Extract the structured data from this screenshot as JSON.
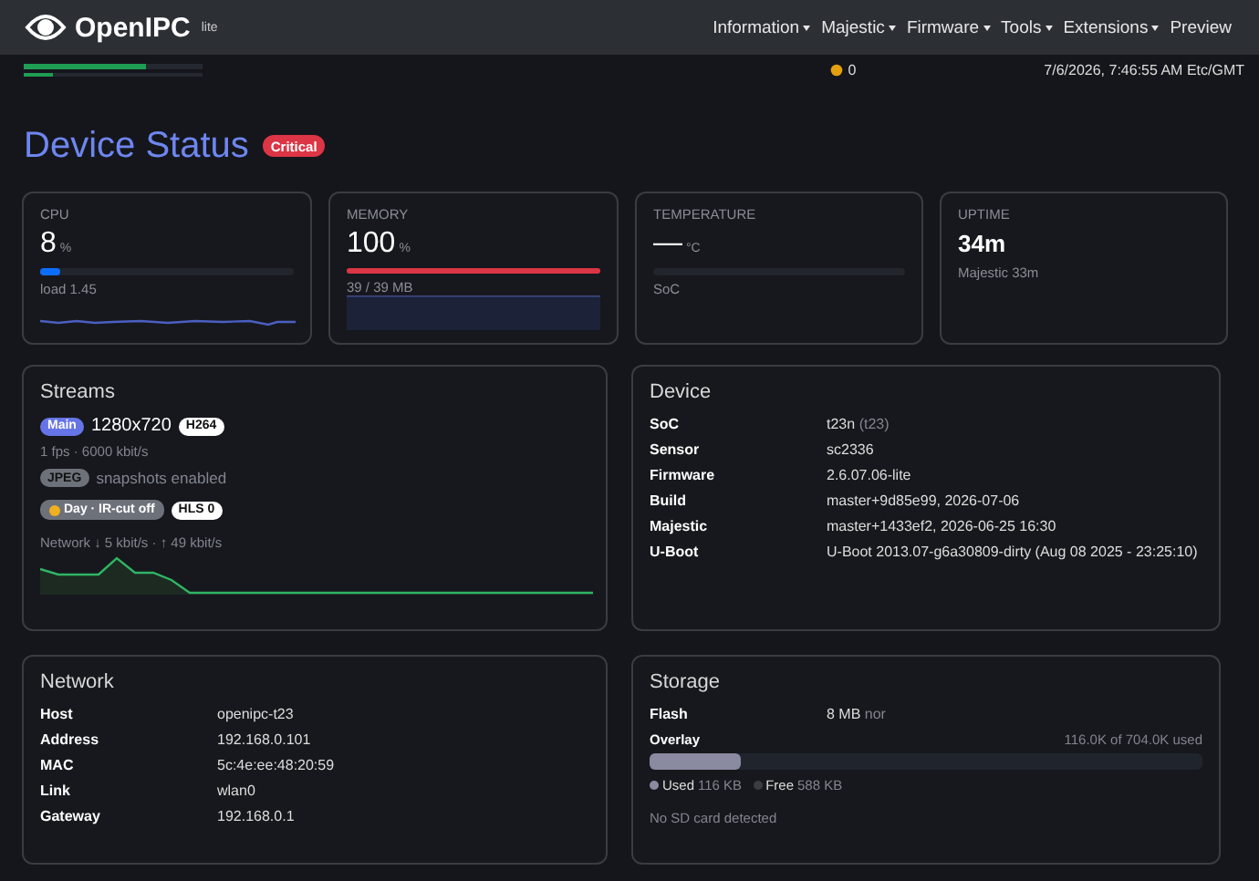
{
  "header": {
    "logo": "OpenIPC",
    "edition": "lite",
    "menu": [
      {
        "label": "Information",
        "dropdown": true
      },
      {
        "label": "Majestic",
        "dropdown": true
      },
      {
        "label": "Firmware",
        "dropdown": true
      },
      {
        "label": "Tools",
        "dropdown": true
      },
      {
        "label": "Extensions",
        "dropdown": true
      },
      {
        "label": "Preview",
        "dropdown": false
      }
    ]
  },
  "status_bar": {
    "meters": [
      {
        "level": 0.68
      },
      {
        "level": 0.16
      }
    ],
    "alerts": "0",
    "datetime": "7/6/2026, 7:46:55 AM Etc/GMT"
  },
  "page": {
    "title": "Device Status",
    "badge": "Critical"
  },
  "stats": [
    {
      "kind": "line",
      "label": "CPU",
      "value": "8",
      "unit": "%",
      "level": 0.08,
      "color": "#0d6efd",
      "note": "load 1.45"
    },
    {
      "kind": "area",
      "label": "MEMORY",
      "value": "100",
      "unit": "%",
      "level": 1,
      "color": "#dc3545",
      "note": "39 / 39 MB"
    },
    {
      "kind": "meter",
      "label": "TEMPERATURE",
      "value": "—",
      "unit": "°C",
      "note": "SoC"
    },
    {
      "kind": "text",
      "label": "UPTIME",
      "value": "34m",
      "note": "Majestic 33m"
    }
  ],
  "streams": {
    "title": "Streams",
    "main": {
      "tag": "Main",
      "resolution": "1280x720",
      "codec": "H264",
      "details": "1 fps · 6000 kbit/s"
    },
    "jpeg": {
      "tag": "JPEG",
      "text": "snapshots enabled"
    },
    "mode": {
      "tag": "Day · IR-cut off",
      "hls": "HLS 0"
    },
    "network": "Network ↓ 5 kbit/s · ↑ 49 kbit/s"
  },
  "device": {
    "title": "Device",
    "rows": [
      {
        "label": "SoC",
        "value": "t23n",
        "note": "(t23)"
      },
      {
        "label": "Sensor",
        "value": "sc2336"
      },
      {
        "label": "Firmware",
        "value": "2.6.07.06-lite"
      },
      {
        "label": "Build",
        "value": "master+9d85e99, 2026-07-06"
      },
      {
        "label": "Majestic",
        "value": "master+1433ef2, 2026-06-25 16:30"
      },
      {
        "label": "U-Boot",
        "value": "U-Boot 2013.07-g6a30809-dirty (Aug 08 2025 - 23:25:10)"
      }
    ]
  },
  "network": {
    "title": "Network",
    "rows": [
      {
        "label": "Host",
        "value": "openipc-t23"
      },
      {
        "label": "Address",
        "value": "192.168.0.101"
      },
      {
        "label": "MAC",
        "value": "5c:4e:ee:48:20:59"
      },
      {
        "label": "Link",
        "value": "wlan0"
      },
      {
        "label": "Gateway",
        "value": "192.168.0.1"
      }
    ]
  },
  "storage": {
    "title": "Storage",
    "flash": {
      "label": "Flash",
      "value": "8 MB",
      "note": "nor"
    },
    "overlay": {
      "label": "Overlay",
      "usage": "116.0K of 704.0K used",
      "level": 0.165
    },
    "legend": [
      {
        "label": "Used",
        "value": "116 KB",
        "color": "#8a8aa0"
      },
      {
        "label": "Free",
        "value": "588 KB",
        "color": "#3a3c44"
      }
    ],
    "sd": "No SD card detected"
  }
}
